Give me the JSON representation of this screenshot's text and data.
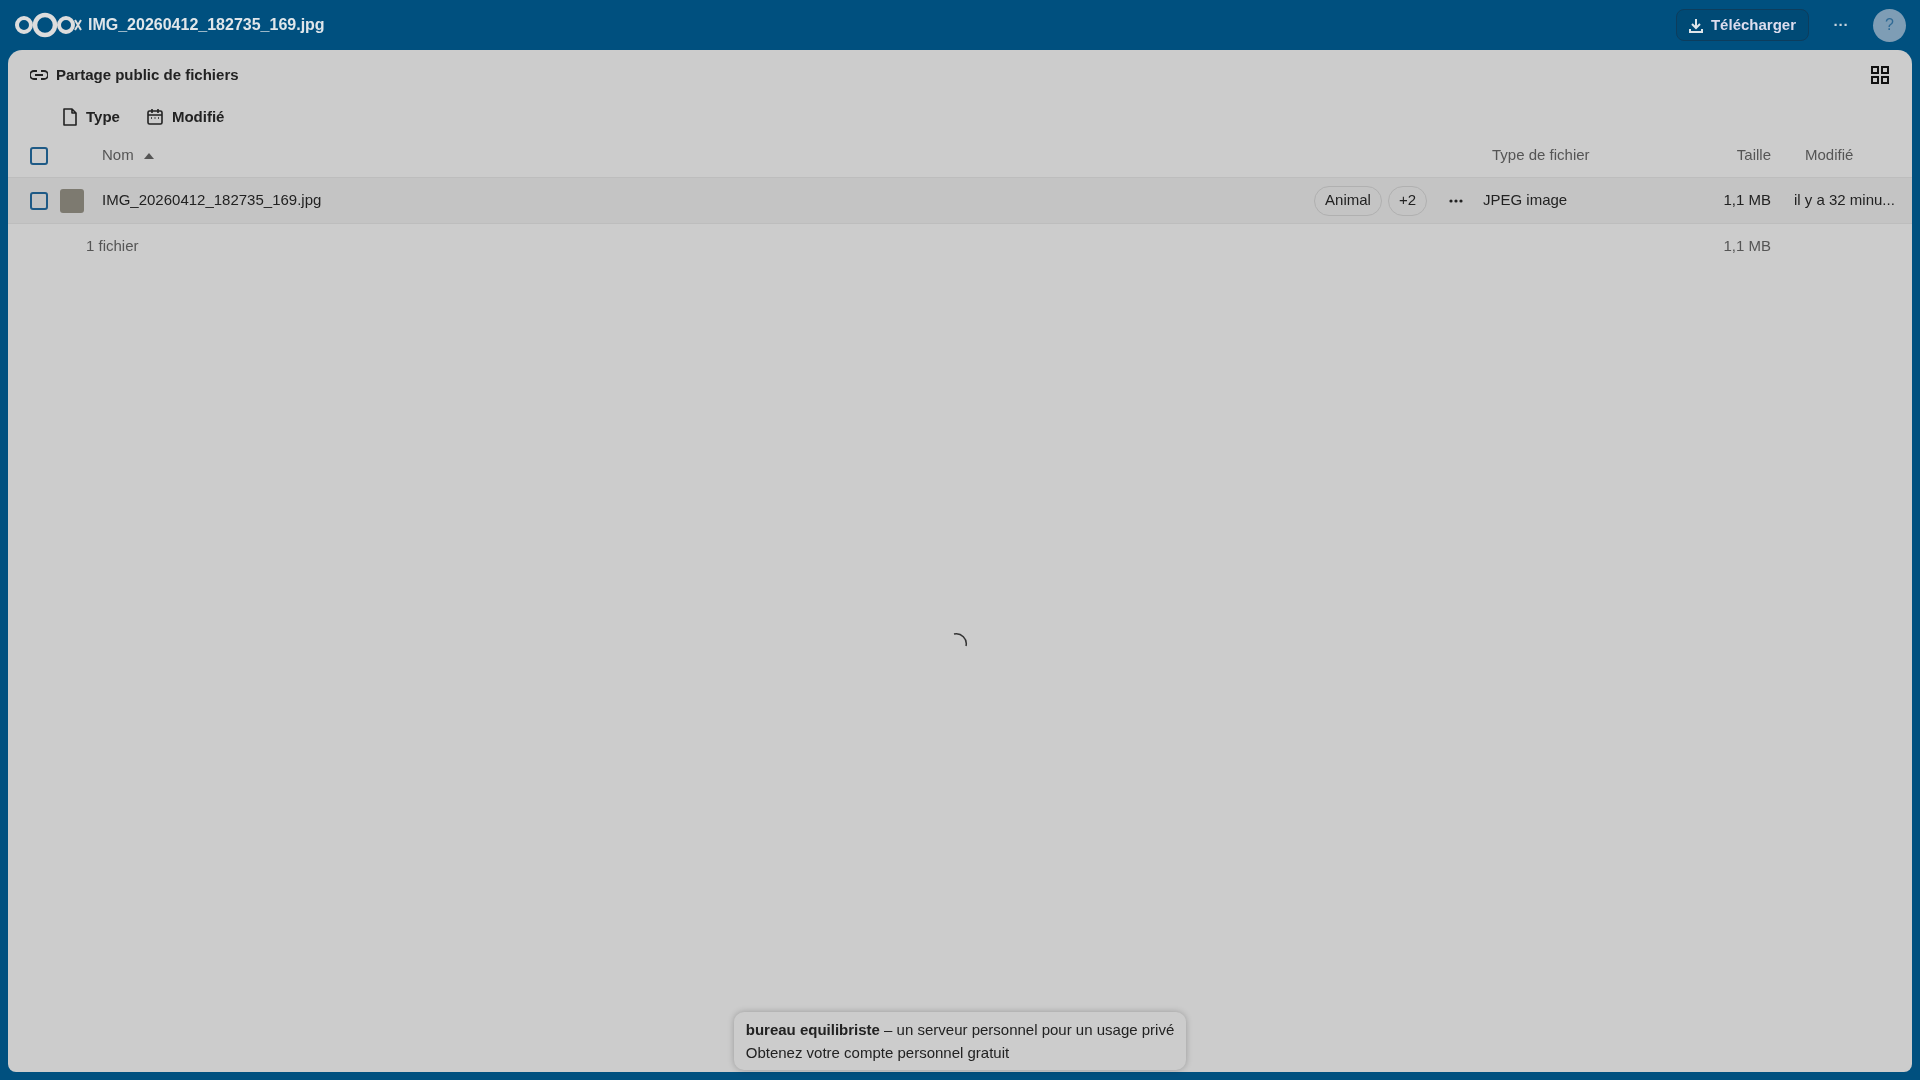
{
  "header": {
    "title": "IMG_20260412_182735_169.jpg",
    "download_label": "Télécharger",
    "more_label": "···",
    "help_label": "?"
  },
  "page_title": "Partage public de fichiers",
  "filters": [
    {
      "kind": "type",
      "label": "Type"
    },
    {
      "kind": "date",
      "label": "Modifié"
    }
  ],
  "table": {
    "select_all_checked": false,
    "columns": [
      {
        "label": "Nom",
        "sorted": true
      },
      {
        "label": "Type de fichier",
        "sorted": false
      },
      {
        "label": "Taille",
        "sorted": false
      },
      {
        "label": "Modifié",
        "sorted": false
      }
    ],
    "rows": [
      {
        "name": "IMG_20260412_182735_169.jpg",
        "checked": false,
        "tags": [
          "Animal",
          "+2"
        ],
        "type": "JPEG image",
        "size": "1,1 MB",
        "modified": "il y a 32 minu..."
      }
    ],
    "summary": {
      "count": "1 fichier",
      "size": "1,1 MB"
    }
  },
  "footer": {
    "text": "**bureau equilibriste** – un serveur personnel pour un usage privé",
    "link": "Obtenez votre compte personnel gratuit"
  }
}
